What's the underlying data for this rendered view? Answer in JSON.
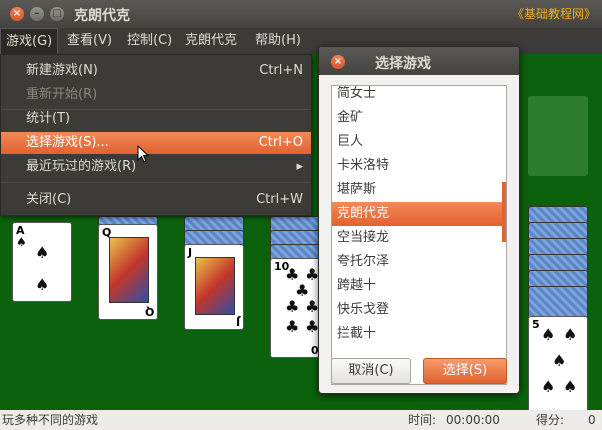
{
  "window": {
    "title": "克朗代克",
    "watermark": "《基础教程网》",
    "close_glyph": "×",
    "minimize_glyph": "–",
    "maximize_glyph": "□"
  },
  "menubar": {
    "items": [
      "游戏(G)",
      "查看(V)",
      "控制(C)",
      "克朗代克",
      "帮助(H)"
    ]
  },
  "game_menu": {
    "items": [
      {
        "label": "新建游戏(N)",
        "accel": "Ctrl+N",
        "state": "normal"
      },
      {
        "label": "重新开始(R)",
        "accel": "",
        "state": "disabled"
      },
      {
        "label": "统计(T)",
        "accel": "",
        "state": "normal"
      },
      {
        "label": "选择游戏(S)...",
        "accel": "Ctrl+O",
        "state": "highlighted"
      },
      {
        "label": "最近玩过的游戏(R)",
        "accel": "▸",
        "state": "normal"
      },
      {
        "label": "关闭(C)",
        "accel": "Ctrl+W",
        "state": "normal"
      }
    ]
  },
  "dialog": {
    "title": "选择游戏",
    "games": [
      "简女士",
      "金矿",
      "巨人",
      "卡米洛特",
      "堪萨斯",
      "克朗代克",
      "空当接龙",
      "夸托尔泽",
      "跨越十",
      "快乐戈登",
      "拦截十"
    ],
    "selected": "克朗代克",
    "cancel_label": "取消(C)",
    "select_label": "选择(S)"
  },
  "cards": {
    "spade_low": {
      "rank": "A",
      "suit": "♠"
    },
    "queen": {
      "rank": "Q",
      "suit": "♠"
    },
    "jack": {
      "rank": "J",
      "suit": "♠"
    },
    "ten_clubs": {
      "rank": "10",
      "suit": "♣"
    },
    "five_spades": {
      "rank": "5",
      "suit": "♠"
    }
  },
  "status": {
    "message": "玩多种不同的游戏",
    "time_label": "时间:",
    "time_value": "00:00:00",
    "score_label": "得分:",
    "score_value": "0"
  },
  "colors": {
    "felt": "#0c620c",
    "accent": "#e1622f",
    "chrome": "#3c3b37"
  }
}
